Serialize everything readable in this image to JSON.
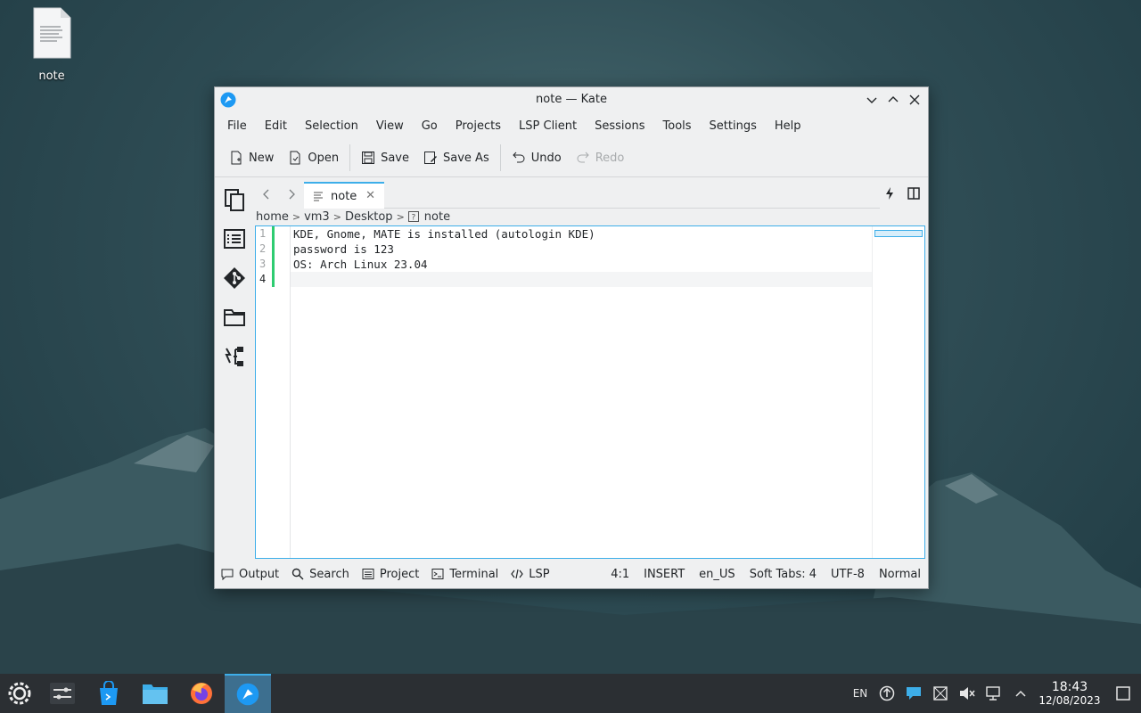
{
  "desktop": {
    "icons": [
      {
        "label": "note",
        "icon": "text-file-icon"
      }
    ]
  },
  "window": {
    "title": "note — Kate",
    "menu": [
      "File",
      "Edit",
      "Selection",
      "View",
      "Go",
      "Projects",
      "LSP Client",
      "Sessions",
      "Tools",
      "Settings",
      "Help"
    ],
    "toolbar": {
      "new": "New",
      "open": "Open",
      "save": "Save",
      "save_as": "Save As",
      "undo": "Undo",
      "redo": "Redo"
    },
    "tab": {
      "label": "note"
    },
    "breadcrumb": [
      "home",
      "vm3",
      "Desktop",
      "note"
    ],
    "editor": {
      "line_numbers": [
        "1",
        "2",
        "3",
        "4"
      ],
      "lines": [
        "KDE, Gnome, MATE is installed (autologin KDE)",
        "password is 123",
        "OS: Arch Linux 23.04",
        ""
      ]
    },
    "statusbar": {
      "output": "Output",
      "search": "Search",
      "project": "Project",
      "terminal": "Terminal",
      "lsp": "LSP",
      "cursor": "4:1",
      "mode": "INSERT",
      "language": "en_US",
      "indent": "Soft Tabs: 4",
      "encoding": "UTF-8",
      "syntax": "Normal"
    }
  },
  "taskbar": {
    "tray": {
      "keyboard_layout": "EN",
      "time": "18:43",
      "date": "12/08/2023"
    }
  },
  "colors": {
    "accent": "#3daee9",
    "taskbar": "#2b2f33",
    "modified_marker": "#2ecc71"
  }
}
